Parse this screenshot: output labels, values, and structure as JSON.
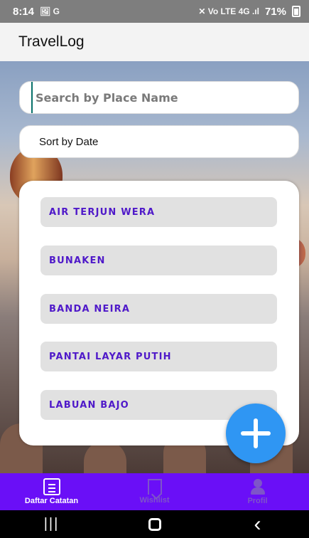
{
  "status_bar": {
    "time": "8:14",
    "notification_icons": "🖼 G",
    "network": "✕ Vo LTE 4G .ıl",
    "battery": "71%"
  },
  "app_bar": {
    "title": "TravelLog"
  },
  "search": {
    "placeholder": "Search by Place Name"
  },
  "sort": {
    "label": "Sort by Date"
  },
  "list": {
    "items": [
      {
        "label": "AIR TERJUN WERA"
      },
      {
        "label": "BUNAKEN"
      },
      {
        "label": "BANDA NEIRA"
      },
      {
        "label": "PANTAI LAYAR PUTIH"
      },
      {
        "label": "LABUAN BAJO"
      }
    ]
  },
  "fab": {
    "icon": "plus-icon"
  },
  "bottom_nav": {
    "items": [
      {
        "label": "Daftar Catatan",
        "icon": "notes-icon",
        "active": true
      },
      {
        "label": "Wishlist",
        "icon": "bookmark-icon",
        "active": false
      },
      {
        "label": "Profil",
        "icon": "profile-icon",
        "active": false
      }
    ]
  },
  "colors": {
    "primary": "#6A0FF7",
    "item_text": "#4F19C9",
    "fab": "#2F96F3"
  }
}
